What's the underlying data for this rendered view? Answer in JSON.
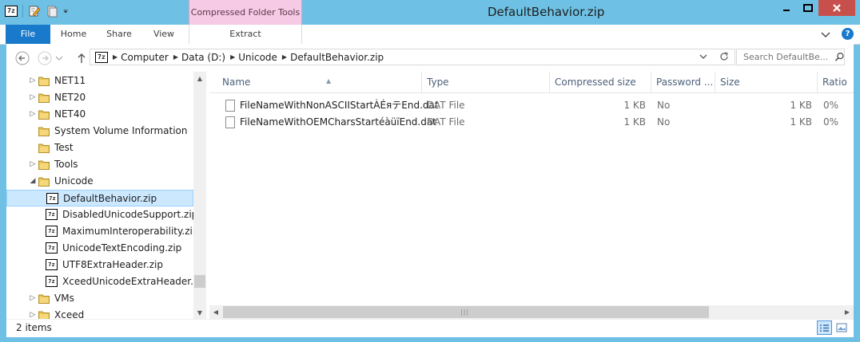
{
  "window": {
    "title": "DefaultBehavior.zip",
    "app_icon_text": "7z"
  },
  "ribbon": {
    "context_group": "Compressed Folder Tools",
    "tabs": [
      {
        "label": "File"
      },
      {
        "label": "Home"
      },
      {
        "label": "Share"
      },
      {
        "label": "View"
      },
      {
        "label": "Extract"
      }
    ],
    "help": "?"
  },
  "address": {
    "crumbs": [
      "Computer",
      "Data (D:)",
      "Unicode",
      "DefaultBehavior.zip"
    ],
    "search_placeholder": "Search DefaultBe..."
  },
  "nav_tree": [
    {
      "label": "NET11",
      "kind": "folder",
      "expandable": true
    },
    {
      "label": "NET20",
      "kind": "folder",
      "expandable": true
    },
    {
      "label": "NET40",
      "kind": "folder",
      "expandable": true
    },
    {
      "label": "System Volume Information",
      "kind": "folder",
      "expandable": false
    },
    {
      "label": "Test",
      "kind": "folder",
      "expandable": false
    },
    {
      "label": "Tools",
      "kind": "folder",
      "expandable": true
    },
    {
      "label": "Unicode",
      "kind": "folder-open",
      "expandable": true
    },
    {
      "label": "DefaultBehavior.zip",
      "kind": "zip",
      "selected": true
    },
    {
      "label": "DisabledUnicodeSupport.zip",
      "kind": "zip"
    },
    {
      "label": "MaximumInteroperability.zip",
      "kind": "zip"
    },
    {
      "label": "UnicodeTextEncoding.zip",
      "kind": "zip"
    },
    {
      "label": "UTF8ExtraHeader.zip",
      "kind": "zip"
    },
    {
      "label": "XceedUnicodeExtraHeader.zip",
      "kind": "zip"
    },
    {
      "label": "VMs",
      "kind": "folder",
      "expandable": true
    },
    {
      "label": "Xceed",
      "kind": "folder",
      "expandable": true
    }
  ],
  "columns": [
    "Name",
    "Type",
    "Compressed size",
    "Password ...",
    "Size",
    "Ratio"
  ],
  "files": [
    {
      "name": "FileNameWithNonASCIIStartÀÉяテEnd.dat",
      "type": "DAT File",
      "compressed": "1 KB",
      "password": "No",
      "size": "1 KB",
      "ratio": "0%"
    },
    {
      "name": "FileNameWithOEMCharsStartéàüïEnd.dat",
      "type": "DAT File",
      "compressed": "1 KB",
      "password": "No",
      "size": "1 KB",
      "ratio": "0%"
    }
  ],
  "status": {
    "item_count": "2 items"
  },
  "colors": {
    "frame": "#6ec1e4",
    "file_tab": "#1979ca",
    "context_tab": "#f6c9e4",
    "selection": "#cce8ff",
    "close_button": "#c7504c"
  }
}
